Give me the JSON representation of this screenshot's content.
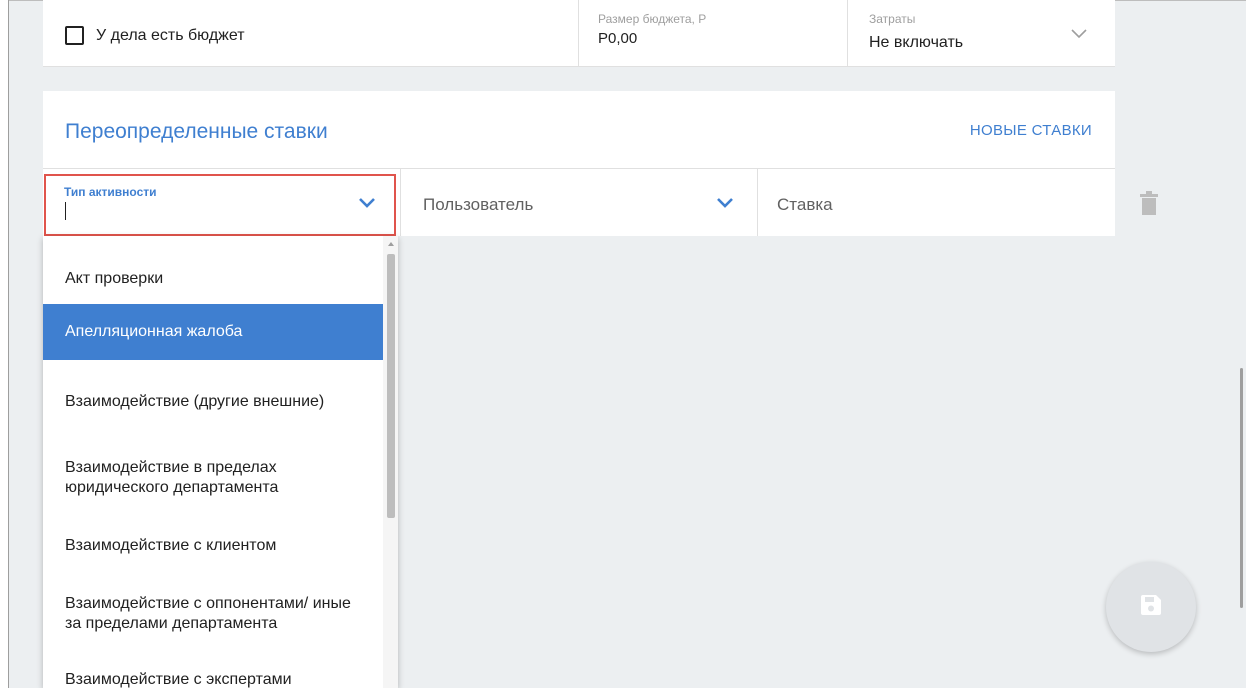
{
  "budget": {
    "checkbox_label": "У дела есть бюджет",
    "size_label": "Размер бюджета, Р",
    "size_value": "Р0,00",
    "costs_label": "Затраты",
    "costs_value": "Не включать"
  },
  "rates": {
    "title": "Переопределенные ставки",
    "new_rates_link": "НОВЫЕ СТАВКИ",
    "activity_type_label": "Тип активности",
    "activity_type_value": "",
    "user_placeholder": "Пользователь",
    "rate_placeholder": "Ставка"
  },
  "dropdown": {
    "selected_index": 1,
    "items": [
      "Акт проверки",
      "Апелляционная жалоба",
      "Взаимодействие (другие внешние)",
      "Взаимодействие в пределах юридического департамента",
      "Взаимодействие с клиентом",
      "Взаимодействие с оппонентами/ иные за пределами департамента",
      "Взаимодействие с экспертами"
    ]
  },
  "icons": {
    "chevron": "chevron-down-icon",
    "trash": "trash-icon",
    "save": "save-icon"
  },
  "colors": {
    "accent": "#3f7fd0",
    "focus_border": "#e0544c",
    "background": "#eceff1"
  }
}
